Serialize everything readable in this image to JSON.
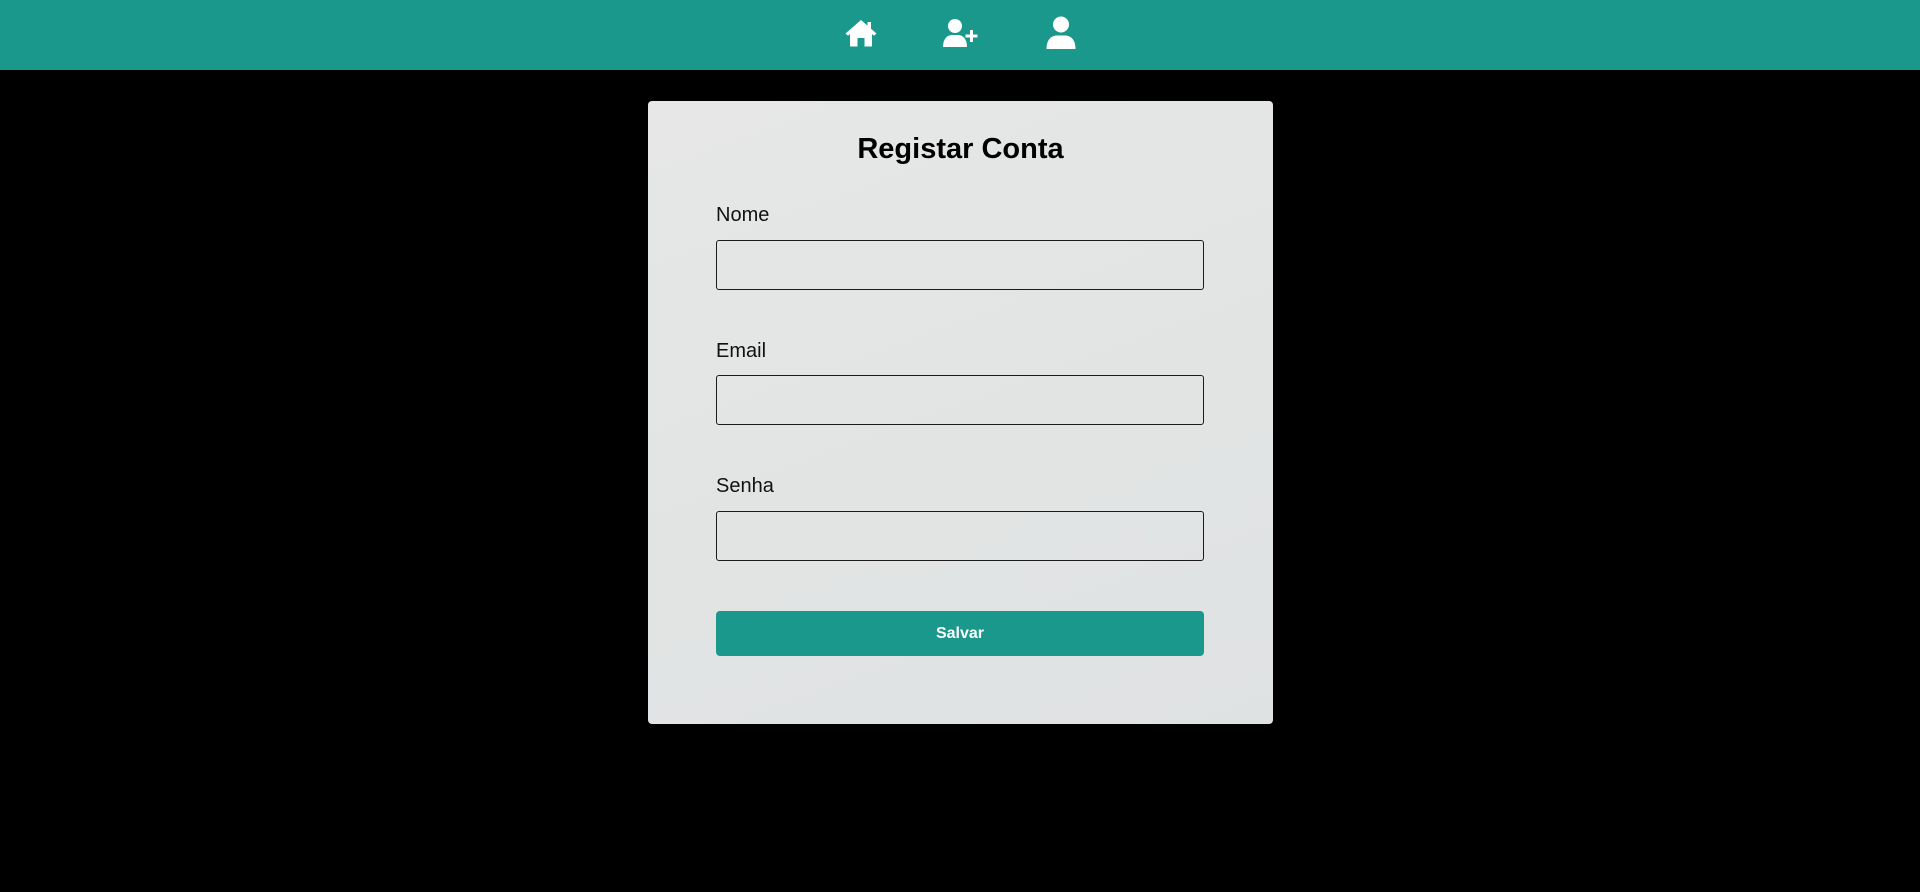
{
  "colors": {
    "accent": "#1a988c",
    "background": "#000000",
    "card": "#e3e5e5"
  },
  "navbar": {
    "icons": [
      {
        "icon": "home-icon"
      },
      {
        "icon": "user-plus-icon"
      },
      {
        "icon": "user-icon"
      }
    ]
  },
  "form": {
    "title": "Registar Conta",
    "fields": [
      {
        "label": "Nome",
        "value": "",
        "placeholder": ""
      },
      {
        "label": "Email",
        "value": "",
        "placeholder": ""
      },
      {
        "label": "Senha",
        "value": "",
        "placeholder": ""
      }
    ],
    "submit_label": "Salvar"
  }
}
